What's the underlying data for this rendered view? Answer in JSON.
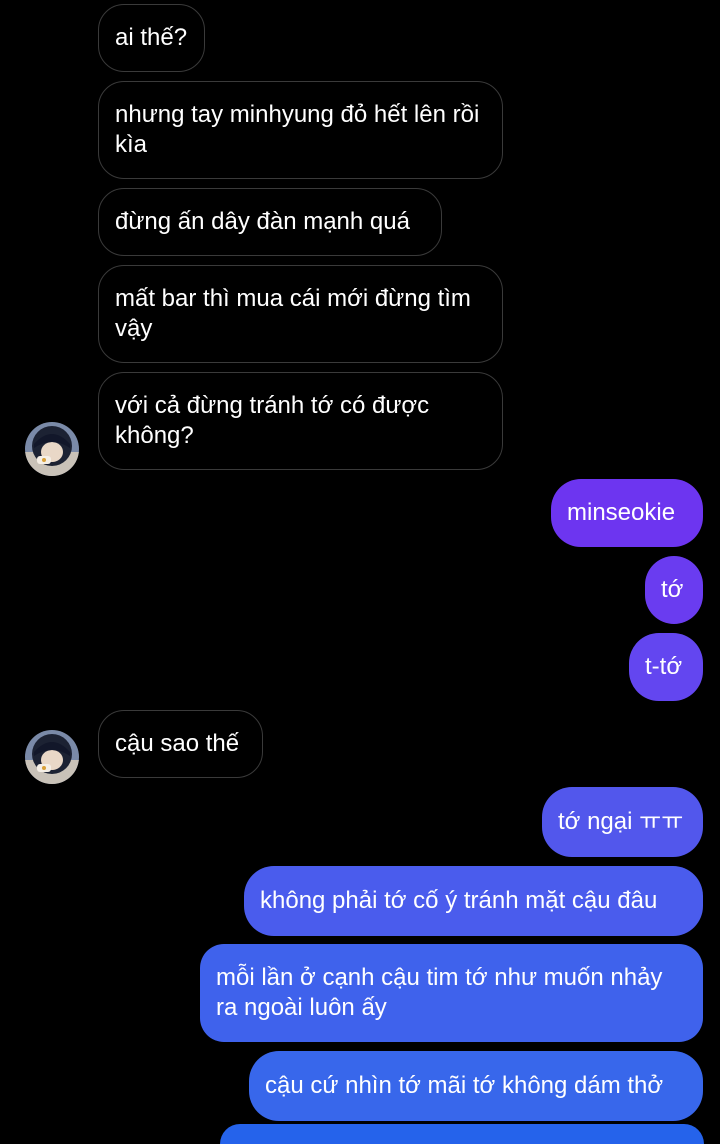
{
  "conversation": {
    "messages": [
      {
        "side": "incoming",
        "text": "ai thế?"
      },
      {
        "side": "incoming",
        "text": "nhưng tay minhyung đỏ hết lên rồi kìa"
      },
      {
        "side": "incoming",
        "text": "đừng ấn dây đàn mạnh quá"
      },
      {
        "side": "incoming",
        "text": "mất bar thì mua cái mới đừng tìm vậy"
      },
      {
        "side": "incoming",
        "text": "với cả đừng tránh tớ có được không?"
      },
      {
        "side": "outgoing",
        "text": "minseokie"
      },
      {
        "side": "outgoing",
        "text": "tớ"
      },
      {
        "side": "outgoing",
        "text": "t-tớ"
      },
      {
        "side": "incoming",
        "text": "cậu sao thế"
      },
      {
        "side": "outgoing",
        "text": "tớ ngại ㅠㅠ"
      },
      {
        "side": "outgoing",
        "text": "không phải tớ cố ý tránh mặt cậu đâu"
      },
      {
        "side": "outgoing",
        "text": "mỗi lần ở cạnh cậu tim tớ như muốn nhảy ra ngoài luôn ấy"
      },
      {
        "side": "outgoing",
        "text": "cậu cứ nhìn tớ mãi tớ không dám thở"
      }
    ]
  },
  "colors": {
    "background": "#000000",
    "incoming_border": "#3a3a3a",
    "outgoing_gradient": [
      "#6d35f0",
      "#6a3cf0",
      "#6346f0",
      "#5a51ee",
      "#5257ec",
      "#4a5ced",
      "#3f62ec",
      "#3867eb",
      "#2f6bea"
    ]
  }
}
